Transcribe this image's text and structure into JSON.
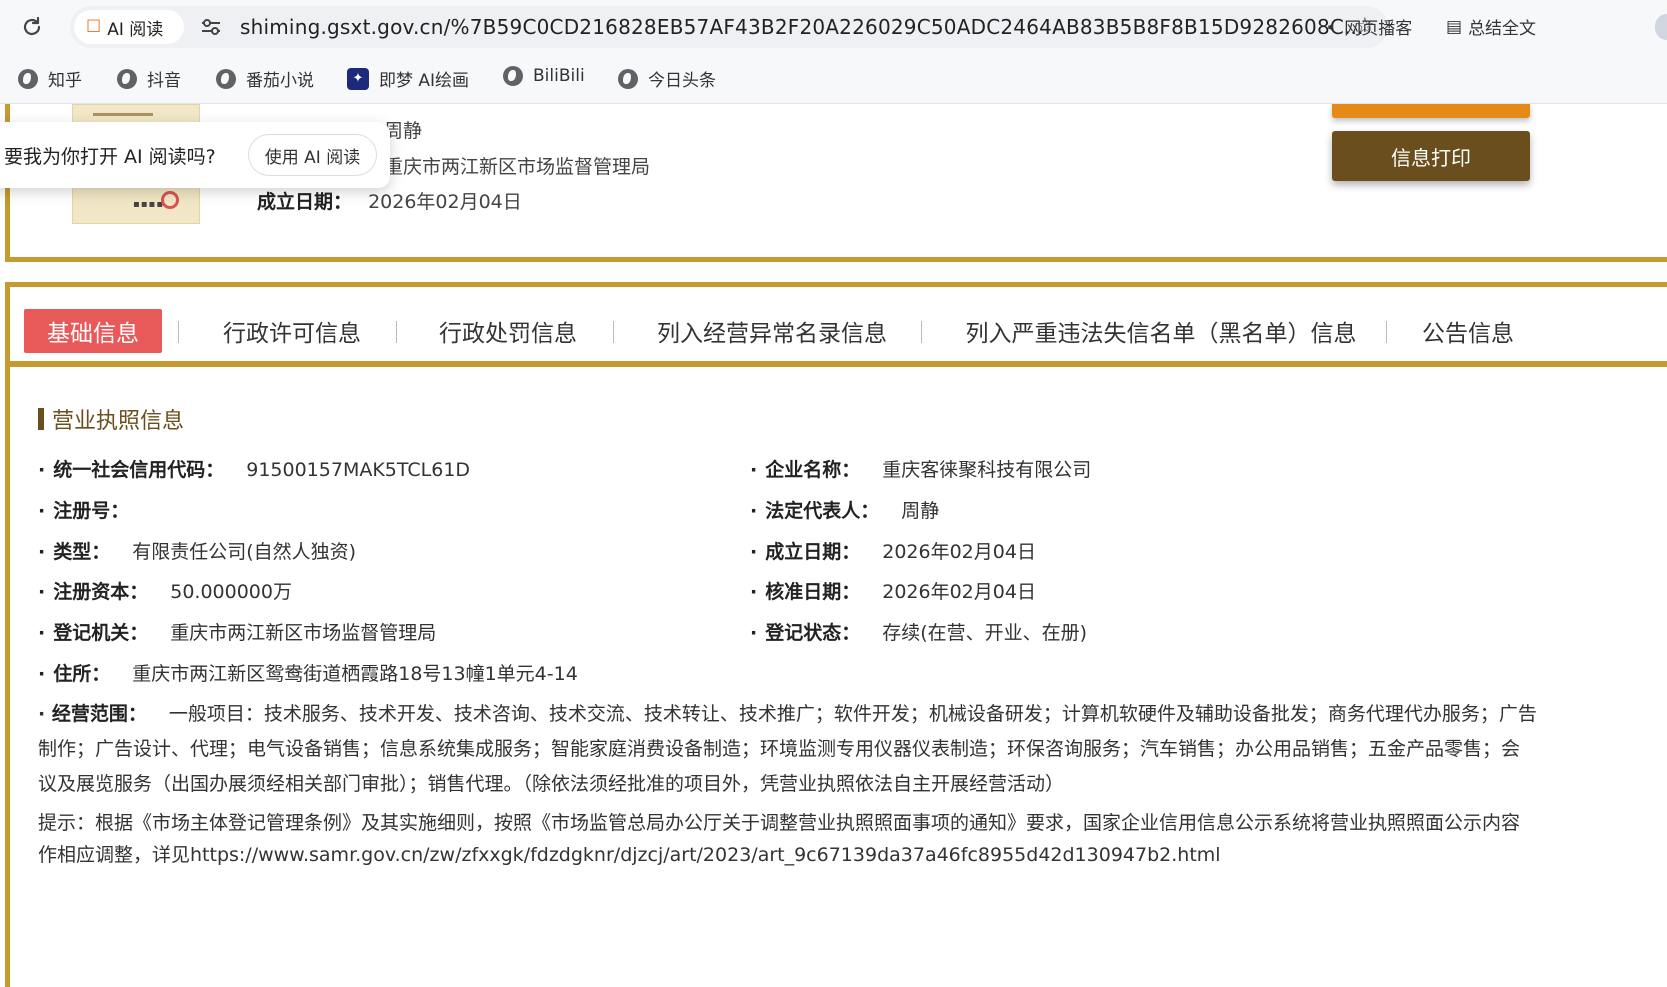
{
  "browser": {
    "ai_chip_label": "AI 阅读",
    "url": "shiming.gsxt.gov.cn/%7B59C0CD216828EB57AF43B2F20A226029C50ADC2464AB83B5B8F8B15D9282608C...",
    "podcast_label": "网页播客",
    "summary_label": "总结全文"
  },
  "bookmarks": [
    {
      "label": "知乎",
      "icon": "globe-icon"
    },
    {
      "label": "抖音",
      "icon": "globe-icon"
    },
    {
      "label": "番茄小说",
      "icon": "globe-icon"
    },
    {
      "label": "即梦 AI绘画",
      "icon": "jimeng-icon"
    },
    {
      "label": "BiliBili",
      "icon": "globe-icon"
    },
    {
      "label": "今日头条",
      "icon": "globe-icon"
    }
  ],
  "ai_prompt": {
    "question": "要我为你打开 AI 阅读吗?",
    "button": "使用 AI 阅读"
  },
  "summary": {
    "legal_rep_value": "周静",
    "authority_value": "重庆市两江新区市场监督管理局",
    "established_label": "成立日期：",
    "established_value": "2026年02月04日",
    "print_button": "信息打印"
  },
  "tabs": [
    {
      "label": "基础信息",
      "active": true
    },
    {
      "label": "行政许可信息",
      "active": false
    },
    {
      "label": "行政处罚信息",
      "active": false
    },
    {
      "label": "列入经营异常名录信息",
      "active": false
    },
    {
      "label": "列入严重违法失信名单（黑名单）信息",
      "active": false
    },
    {
      "label": "公告信息",
      "active": false
    }
  ],
  "license": {
    "section_title": "营业执照信息",
    "fields": {
      "credit_code": {
        "label": "统一社会信用代码：",
        "value": "91500157MAK5TCL61D"
      },
      "company_name": {
        "label": "企业名称：",
        "value": "重庆客徕聚科技有限公司"
      },
      "reg_no": {
        "label": "注册号：",
        "value": ""
      },
      "legal_rep": {
        "label": "法定代表人：",
        "value": "周静"
      },
      "type": {
        "label": "类型：",
        "value": "有限责任公司(自然人独资)"
      },
      "established": {
        "label": "成立日期：",
        "value": "2026年02月04日"
      },
      "capital": {
        "label": "注册资本：",
        "value": "50.000000万"
      },
      "approval_date": {
        "label": "核准日期：",
        "value": "2026年02月04日"
      },
      "authority": {
        "label": "登记机关：",
        "value": "重庆市两江新区市场监督管理局"
      },
      "status": {
        "label": "登记状态：",
        "value": "存续(在营、开业、在册)"
      },
      "address": {
        "label": "住所：",
        "value": "重庆市两江新区鸳鸯街道栖霞路18号13幢1单元4-14"
      }
    },
    "scope_label": "经营范围：",
    "scope_value": "一般项目：技术服务、技术开发、技术咨询、技术交流、技术转让、技术推广；软件开发；机械设备研发；计算机软硬件及辅助设备批发；商务代理代办服务；广告制作；广告设计、代理；电气设备销售；信息系统集成服务；智能家庭消费设备制造；环境监测专用仪器仪表制造；环保咨询服务；汽车销售；办公用品销售；五金产品零售；会议及展览服务（出国办展须经相关部门审批）；销售代理。（除依法须经批准的项目外，凭营业执照依法自主开展经营活动）",
    "tip": "提示：根据《市场主体登记管理条例》及其实施细则，按照《市场监管总局办公厅关于调整营业执照照面事项的通知》要求，国家企业信用信息公示系统将营业执照照面公示内容作相应调整，详见https://www.samr.gov.cn/zw/zfxxgk/fdzdgknr/djzcj/art/2023/art_9c67139da37a46fc8955d42d130947b2.html"
  },
  "colors": {
    "gold_border": "#c59a2e",
    "brown": "#6b4e1d",
    "active_tab": "#e85a5a",
    "orange_button": "#e58a16"
  }
}
